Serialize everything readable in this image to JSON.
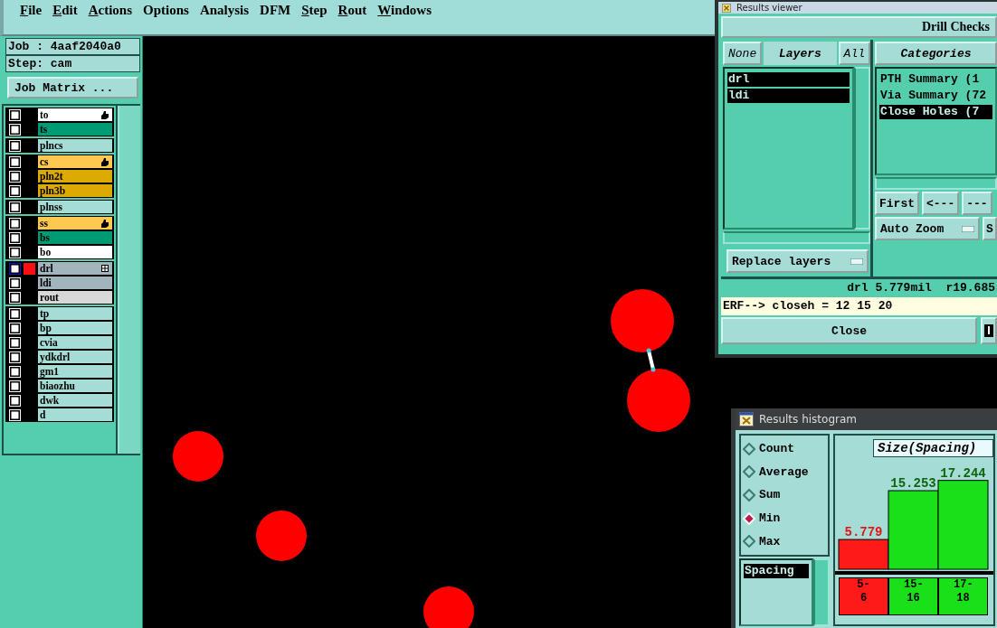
{
  "menu": [
    {
      "label": "File",
      "mnemonic": true
    },
    {
      "label": "Edit",
      "mnemonic": true
    },
    {
      "label": "Actions",
      "mnemonic": true
    },
    {
      "label": "Options",
      "mnemonic": false
    },
    {
      "label": "Analysis",
      "mnemonic": false
    },
    {
      "label": "DFM",
      "mnemonic": false
    },
    {
      "label": "Step",
      "mnemonic": true
    },
    {
      "label": "Rout",
      "mnemonic": true
    },
    {
      "label": "Windows",
      "mnemonic": true
    }
  ],
  "job": {
    "job_label": "Job : 4aaf2040a0",
    "step_label": "Step: cam",
    "matrix_button": "Job Matrix ..."
  },
  "layer_groups": [
    {
      "layers": [
        {
          "name": "to",
          "color": "#ffffff",
          "checked": false,
          "work_layer": false,
          "hand": true
        },
        {
          "name": "ts",
          "color": "#009a74",
          "checked": false,
          "work_layer": false,
          "hand": false
        }
      ]
    },
    {
      "layers": [
        {
          "name": "plncs",
          "color": "#a6dcd6",
          "checked": false,
          "work_layer": false,
          "hand": false
        }
      ]
    },
    {
      "layers": [
        {
          "name": "cs",
          "color": "#ffc850",
          "checked": false,
          "work_layer": false,
          "hand": true
        },
        {
          "name": "pln2t",
          "color": "#dcaa00",
          "checked": false,
          "work_layer": false,
          "hand": false
        },
        {
          "name": "pln3b",
          "color": "#dcaa00",
          "checked": false,
          "work_layer": false,
          "hand": false
        }
      ]
    },
    {
      "layers": [
        {
          "name": "plnss",
          "color": "#a6dcd6",
          "checked": false,
          "work_layer": false,
          "hand": false
        }
      ]
    },
    {
      "layers": [
        {
          "name": "ss",
          "color": "#ffc850",
          "checked": false,
          "work_layer": false,
          "hand": true
        },
        {
          "name": "bs",
          "color": "#009a74",
          "checked": false,
          "work_layer": false,
          "hand": false
        },
        {
          "name": "bo",
          "color": "#ffffff",
          "checked": false,
          "work_layer": false,
          "hand": false
        }
      ]
    },
    {
      "layers": [
        {
          "name": "drl",
          "color": "#a2b4bc",
          "checked": false,
          "work_layer": true,
          "hand": false
        },
        {
          "name": "ldi",
          "color": "#a2b4bc",
          "checked": false,
          "work_layer": false,
          "hand": false
        },
        {
          "name": "rout",
          "color": "#d8d8d8",
          "checked": false,
          "work_layer": false,
          "hand": false
        }
      ]
    },
    {
      "layers": [
        {
          "name": "tp",
          "color": "#a6dcd6",
          "checked": false,
          "work_layer": false,
          "hand": false
        },
        {
          "name": "bp",
          "color": "#a6dcd6",
          "checked": false,
          "work_layer": false,
          "hand": false
        },
        {
          "name": "cvia",
          "color": "#a6dcd6",
          "checked": false,
          "work_layer": false,
          "hand": false
        },
        {
          "name": "ydkdrl",
          "color": "#a6dcd6",
          "checked": false,
          "work_layer": false,
          "hand": false
        },
        {
          "name": "gm1",
          "color": "#a6dcd6",
          "checked": false,
          "work_layer": false,
          "hand": false
        },
        {
          "name": "biaozhu",
          "color": "#a6dcd6",
          "checked": false,
          "work_layer": false,
          "hand": false
        },
        {
          "name": "dwk",
          "color": "#a6dcd6",
          "checked": false,
          "work_layer": false,
          "hand": false
        },
        {
          "name": "d",
          "color": "#a6dcd6",
          "checked": false,
          "work_layer": false,
          "hand": false
        }
      ]
    }
  ],
  "results_viewer": {
    "title": "Results viewer",
    "header": "Drill Checks",
    "layer_buttons": {
      "none": "None",
      "label": "Layers",
      "all": "All"
    },
    "layers": [
      {
        "label": "drl",
        "selected": true
      },
      {
        "label": "ldi",
        "selected": true
      }
    ],
    "replace_button": "Replace layers",
    "categories_header": "Categories",
    "categories": [
      {
        "label": "PTH Summary (1",
        "selected": false
      },
      {
        "label": "Via Summary (72",
        "selected": false
      },
      {
        "label": "Close Holes (7",
        "selected": true
      }
    ],
    "nav_buttons": [
      "First",
      "<---",
      "---"
    ],
    "zoom_button": "Auto Zoom",
    "side_button": "S",
    "status": "drl 5.779mil  r19.685",
    "command": "ERF--> closeh = 12 15 20",
    "close_button": "Close"
  },
  "histogram": {
    "title": "Results histogram",
    "modes": [
      {
        "label": "Count",
        "selected": false
      },
      {
        "label": "Average",
        "selected": false
      },
      {
        "label": "Sum",
        "selected": false
      },
      {
        "label": "Min",
        "selected": true
      },
      {
        "label": "Max",
        "selected": false
      }
    ],
    "measures": [
      {
        "label": "Spacing",
        "selected": true
      }
    ],
    "chart_data": {
      "type": "bar",
      "title": "Size(Spacing)",
      "categories": [
        "5-6",
        "15-16",
        "17-18"
      ],
      "data_labels": true,
      "series": [
        {
          "color": "#ff1a1a",
          "values": [
            5.779,
            null,
            null
          ]
        },
        {
          "color": "#19e019",
          "values": [
            null,
            15.253,
            17.244
          ]
        }
      ]
    }
  }
}
